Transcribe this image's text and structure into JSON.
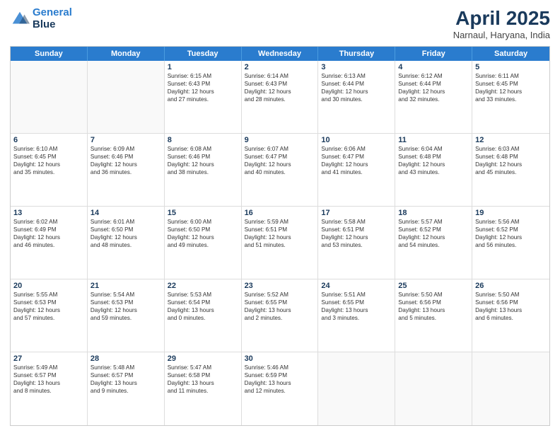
{
  "header": {
    "logo_line1": "General",
    "logo_line2": "Blue",
    "title": "April 2025",
    "subtitle": "Narnaul, Haryana, India"
  },
  "weekdays": [
    "Sunday",
    "Monday",
    "Tuesday",
    "Wednesday",
    "Thursday",
    "Friday",
    "Saturday"
  ],
  "rows": [
    [
      {
        "day": "",
        "lines": []
      },
      {
        "day": "",
        "lines": []
      },
      {
        "day": "1",
        "lines": [
          "Sunrise: 6:15 AM",
          "Sunset: 6:43 PM",
          "Daylight: 12 hours",
          "and 27 minutes."
        ]
      },
      {
        "day": "2",
        "lines": [
          "Sunrise: 6:14 AM",
          "Sunset: 6:43 PM",
          "Daylight: 12 hours",
          "and 28 minutes."
        ]
      },
      {
        "day": "3",
        "lines": [
          "Sunrise: 6:13 AM",
          "Sunset: 6:44 PM",
          "Daylight: 12 hours",
          "and 30 minutes."
        ]
      },
      {
        "day": "4",
        "lines": [
          "Sunrise: 6:12 AM",
          "Sunset: 6:44 PM",
          "Daylight: 12 hours",
          "and 32 minutes."
        ]
      },
      {
        "day": "5",
        "lines": [
          "Sunrise: 6:11 AM",
          "Sunset: 6:45 PM",
          "Daylight: 12 hours",
          "and 33 minutes."
        ]
      }
    ],
    [
      {
        "day": "6",
        "lines": [
          "Sunrise: 6:10 AM",
          "Sunset: 6:45 PM",
          "Daylight: 12 hours",
          "and 35 minutes."
        ]
      },
      {
        "day": "7",
        "lines": [
          "Sunrise: 6:09 AM",
          "Sunset: 6:46 PM",
          "Daylight: 12 hours",
          "and 36 minutes."
        ]
      },
      {
        "day": "8",
        "lines": [
          "Sunrise: 6:08 AM",
          "Sunset: 6:46 PM",
          "Daylight: 12 hours",
          "and 38 minutes."
        ]
      },
      {
        "day": "9",
        "lines": [
          "Sunrise: 6:07 AM",
          "Sunset: 6:47 PM",
          "Daylight: 12 hours",
          "and 40 minutes."
        ]
      },
      {
        "day": "10",
        "lines": [
          "Sunrise: 6:06 AM",
          "Sunset: 6:47 PM",
          "Daylight: 12 hours",
          "and 41 minutes."
        ]
      },
      {
        "day": "11",
        "lines": [
          "Sunrise: 6:04 AM",
          "Sunset: 6:48 PM",
          "Daylight: 12 hours",
          "and 43 minutes."
        ]
      },
      {
        "day": "12",
        "lines": [
          "Sunrise: 6:03 AM",
          "Sunset: 6:48 PM",
          "Daylight: 12 hours",
          "and 45 minutes."
        ]
      }
    ],
    [
      {
        "day": "13",
        "lines": [
          "Sunrise: 6:02 AM",
          "Sunset: 6:49 PM",
          "Daylight: 12 hours",
          "and 46 minutes."
        ]
      },
      {
        "day": "14",
        "lines": [
          "Sunrise: 6:01 AM",
          "Sunset: 6:50 PM",
          "Daylight: 12 hours",
          "and 48 minutes."
        ]
      },
      {
        "day": "15",
        "lines": [
          "Sunrise: 6:00 AM",
          "Sunset: 6:50 PM",
          "Daylight: 12 hours",
          "and 49 minutes."
        ]
      },
      {
        "day": "16",
        "lines": [
          "Sunrise: 5:59 AM",
          "Sunset: 6:51 PM",
          "Daylight: 12 hours",
          "and 51 minutes."
        ]
      },
      {
        "day": "17",
        "lines": [
          "Sunrise: 5:58 AM",
          "Sunset: 6:51 PM",
          "Daylight: 12 hours",
          "and 53 minutes."
        ]
      },
      {
        "day": "18",
        "lines": [
          "Sunrise: 5:57 AM",
          "Sunset: 6:52 PM",
          "Daylight: 12 hours",
          "and 54 minutes."
        ]
      },
      {
        "day": "19",
        "lines": [
          "Sunrise: 5:56 AM",
          "Sunset: 6:52 PM",
          "Daylight: 12 hours",
          "and 56 minutes."
        ]
      }
    ],
    [
      {
        "day": "20",
        "lines": [
          "Sunrise: 5:55 AM",
          "Sunset: 6:53 PM",
          "Daylight: 12 hours",
          "and 57 minutes."
        ]
      },
      {
        "day": "21",
        "lines": [
          "Sunrise: 5:54 AM",
          "Sunset: 6:53 PM",
          "Daylight: 12 hours",
          "and 59 minutes."
        ]
      },
      {
        "day": "22",
        "lines": [
          "Sunrise: 5:53 AM",
          "Sunset: 6:54 PM",
          "Daylight: 13 hours",
          "and 0 minutes."
        ]
      },
      {
        "day": "23",
        "lines": [
          "Sunrise: 5:52 AM",
          "Sunset: 6:55 PM",
          "Daylight: 13 hours",
          "and 2 minutes."
        ]
      },
      {
        "day": "24",
        "lines": [
          "Sunrise: 5:51 AM",
          "Sunset: 6:55 PM",
          "Daylight: 13 hours",
          "and 3 minutes."
        ]
      },
      {
        "day": "25",
        "lines": [
          "Sunrise: 5:50 AM",
          "Sunset: 6:56 PM",
          "Daylight: 13 hours",
          "and 5 minutes."
        ]
      },
      {
        "day": "26",
        "lines": [
          "Sunrise: 5:50 AM",
          "Sunset: 6:56 PM",
          "Daylight: 13 hours",
          "and 6 minutes."
        ]
      }
    ],
    [
      {
        "day": "27",
        "lines": [
          "Sunrise: 5:49 AM",
          "Sunset: 6:57 PM",
          "Daylight: 13 hours",
          "and 8 minutes."
        ]
      },
      {
        "day": "28",
        "lines": [
          "Sunrise: 5:48 AM",
          "Sunset: 6:57 PM",
          "Daylight: 13 hours",
          "and 9 minutes."
        ]
      },
      {
        "day": "29",
        "lines": [
          "Sunrise: 5:47 AM",
          "Sunset: 6:58 PM",
          "Daylight: 13 hours",
          "and 11 minutes."
        ]
      },
      {
        "day": "30",
        "lines": [
          "Sunrise: 5:46 AM",
          "Sunset: 6:59 PM",
          "Daylight: 13 hours",
          "and 12 minutes."
        ]
      },
      {
        "day": "",
        "lines": []
      },
      {
        "day": "",
        "lines": []
      },
      {
        "day": "",
        "lines": []
      }
    ]
  ]
}
